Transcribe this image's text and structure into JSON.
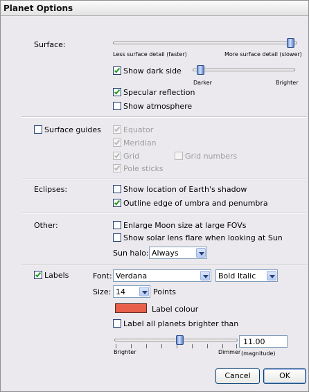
{
  "window": {
    "title": "Planet Options"
  },
  "surface": {
    "label": "Surface:",
    "slider_value": 1.0,
    "left_caption": "Less surface detail (faster)",
    "right_caption": "More surface detail (slower)",
    "dark_side": {
      "label": "Show dark side",
      "checked": true,
      "slider_value": 0.1,
      "left_caption": "Darker",
      "right_caption": "Brighter"
    },
    "specular": {
      "label": "Specular reflection",
      "checked": true
    },
    "atmosphere": {
      "label": "Show atmosphere",
      "checked": false
    }
  },
  "surface_guides": {
    "label": "Surface guides",
    "checked": false,
    "equator": "Equator",
    "meridian": "Meridian",
    "grid": "Grid",
    "grid_numbers": "Grid numbers",
    "pole_sticks": "Pole sticks"
  },
  "eclipses": {
    "label": "Eclipses:",
    "earth_shadow": {
      "label": "Show location of Earth's shadow",
      "checked": false
    },
    "umbra": {
      "label": "Outline edge of umbra and penumbra",
      "checked": true
    }
  },
  "other": {
    "label": "Other:",
    "enlarge_moon": {
      "label": "Enlarge Moon size at large FOVs",
      "checked": false
    },
    "lens_flare": {
      "label": "Show solar lens flare when looking at Sun",
      "checked": false
    },
    "sun_halo_label": "Sun halo:",
    "sun_halo_value": "Always"
  },
  "labels": {
    "label": "Labels",
    "checked": true,
    "font_label": "Font:",
    "font_value": "Verdana",
    "style_value": "Bold Italic",
    "size_label": "Size:",
    "size_value": "14",
    "points_label": "Points",
    "colour_label": "Label colour",
    "colour": "#e8604a",
    "all_brighter": {
      "label": "Label all planets brighter than",
      "checked": false
    },
    "mag_slider_value": 0.62,
    "mag_value": "11.00",
    "mag_unit": "(magnitude)",
    "brighter_caption": "Brighter",
    "dimmer_caption": "Dimmer"
  },
  "buttons": {
    "cancel": "Cancel",
    "ok": "OK"
  }
}
